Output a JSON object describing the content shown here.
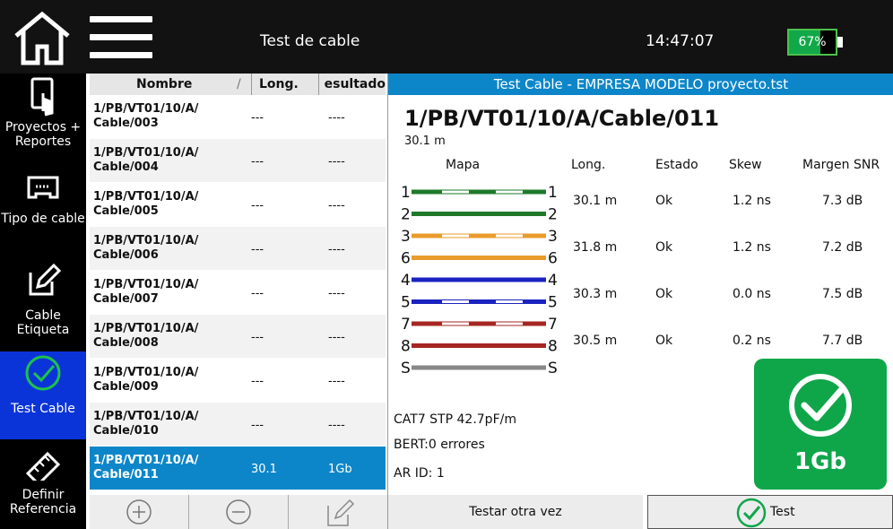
{
  "topbar": {
    "title": "Test de cable",
    "time": "14:47:07",
    "battery": "67%"
  },
  "sidebar": {
    "items": [
      {
        "label": "Proyectos + Reportes"
      },
      {
        "label": "Tipo de cable"
      },
      {
        "label": "Cable Etiqueta"
      },
      {
        "label": "Test Cable"
      },
      {
        "label": "Definir Referencia"
      }
    ]
  },
  "list": {
    "headers": {
      "name": "Nombre",
      "length": "Long.",
      "result": "Resultado"
    },
    "rows": [
      {
        "name": "1/PB/VT01/10/A/ Cable/003",
        "length": "---",
        "result": "----"
      },
      {
        "name": "1/PB/VT01/10/A/ Cable/004",
        "length": "---",
        "result": "----"
      },
      {
        "name": "1/PB/VT01/10/A/ Cable/005",
        "length": "---",
        "result": "----"
      },
      {
        "name": "1/PB/VT01/10/A/ Cable/006",
        "length": "---",
        "result": "----"
      },
      {
        "name": "1/PB/VT01/10/A/ Cable/007",
        "length": "---",
        "result": "----"
      },
      {
        "name": "1/PB/VT01/10/A/ Cable/008",
        "length": "---",
        "result": "----"
      },
      {
        "name": "1/PB/VT01/10/A/ Cable/009",
        "length": "---",
        "result": "----"
      },
      {
        "name": "1/PB/VT01/10/A/ Cable/010",
        "length": "---",
        "result": "----"
      },
      {
        "name": "1/PB/VT01/10/A/ Cable/011",
        "length": "30.1",
        "result": "1Gb"
      }
    ]
  },
  "detail": {
    "header": "Test Cable - EMPRESA MODELO proyecto.tst",
    "cable_name": "1/PB/VT01/10/A/Cable/011",
    "cable_length": "30.1 m",
    "columns": {
      "map": "Mapa",
      "length": "Long.",
      "status": "Estado",
      "skew": "Skew",
      "snr": "Margen SNR"
    },
    "pairs": [
      {
        "length": "30.1 m",
        "status": "Ok",
        "skew": "1.2 ns",
        "snr": "7.3 dB"
      },
      {
        "length": "31.8 m",
        "status": "Ok",
        "skew": "1.2 ns",
        "snr": "7.2 dB"
      },
      {
        "length": "30.3 m",
        "status": "Ok",
        "skew": "0.0 ns",
        "snr": "7.5 dB"
      },
      {
        "length": "30.5 m",
        "status": "Ok",
        "skew": "0.2 ns",
        "snr": "7.7 dB"
      }
    ],
    "wires": [
      {
        "label": "1",
        "color": "#1f7a2a",
        "striped": true
      },
      {
        "label": "2",
        "color": "#1f7a2a",
        "striped": false
      },
      {
        "label": "3",
        "color": "#e99b2b",
        "striped": true
      },
      {
        "label": "6",
        "color": "#e99b2b",
        "striped": false
      },
      {
        "label": "4",
        "color": "#1a23c0",
        "striped": false
      },
      {
        "label": "5",
        "color": "#1a23c0",
        "striped": true
      },
      {
        "label": "7",
        "color": "#a52622",
        "striped": true
      },
      {
        "label": "8",
        "color": "#a52622",
        "striped": false
      },
      {
        "label": "S",
        "color": "#888888",
        "striped": false
      }
    ],
    "cable_type": "CAT7 STP  42.7pF/m",
    "bert": "BERT:0 errores",
    "ar_id": "AR ID: 1",
    "badge": "1Gb"
  },
  "buttons": {
    "retest": "Testar otra vez",
    "test": "Test"
  }
}
